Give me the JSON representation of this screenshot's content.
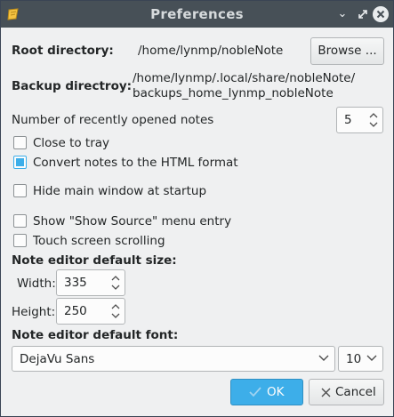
{
  "window": {
    "title": "Preferences"
  },
  "root": {
    "label": "Root directory:",
    "value": "/home/lynmp/nobleNote",
    "browse_label": "Browse ..."
  },
  "backup": {
    "label": "Backup directroy:",
    "value_line1": "/home/lynmp/.local/share/nobleNote/",
    "value_line2": "backups_home_lynmp_nobleNote"
  },
  "recent": {
    "label": "Number of recently opened notes",
    "value": "5"
  },
  "checkboxes": [
    {
      "label": "Close to tray",
      "checked": false
    },
    {
      "label": "Convert notes to the HTML format",
      "checked": true
    },
    {
      "label": "Hide main window at startup",
      "checked": false
    },
    {
      "label": "Show \"Show Source\" menu entry",
      "checked": false
    },
    {
      "label": "Touch screen scrolling",
      "checked": false
    }
  ],
  "size": {
    "heading": "Note editor default size:",
    "width_label": "Width:",
    "width_value": "335",
    "height_label": "Height:",
    "height_value": "250"
  },
  "font": {
    "heading": "Note editor default font:",
    "family": "DejaVu Sans",
    "size": "10"
  },
  "buttons": {
    "ok": "OK",
    "cancel": "Cancel"
  },
  "colors": {
    "titlebar": "#475057",
    "accent": "#3daee9",
    "background": "#eff0f1"
  }
}
